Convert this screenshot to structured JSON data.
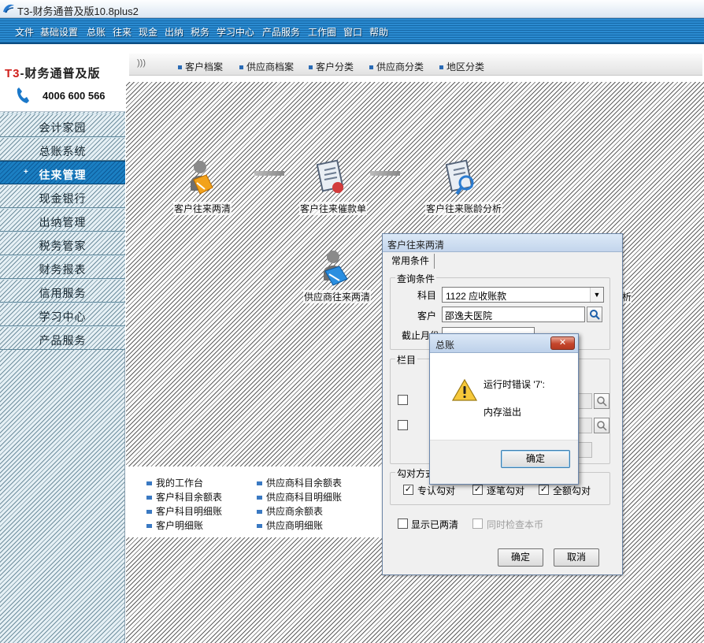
{
  "window": {
    "title": "T3-财务通普及版10.8plus2"
  },
  "menu": [
    "文件",
    "基础设置",
    "总账",
    "往来",
    "现金",
    "出纳",
    "税务",
    "学习中心",
    "产品服务",
    "工作圈",
    "窗口",
    "帮助"
  ],
  "logo": {
    "brand_t3": "T3",
    "brand_rest": "-财务通普及版",
    "phone": "4006 600 566"
  },
  "nav": {
    "items": [
      "会计家园",
      "总账系统",
      "往来管理",
      "现金银行",
      "出纳管理",
      "税务管家",
      "财务报表",
      "信用服务",
      "学习中心",
      "产品服务"
    ],
    "active_index": 2,
    "active_marker": "+"
  },
  "quicklinks": [
    "客户档案",
    "供应商档案",
    "客户分类",
    "供应商分类",
    "地区分类"
  ],
  "flow": {
    "customer_clear": "客户往来两清",
    "customer_statement": "客户往来催款单",
    "customer_aging": "客户往来账龄分析",
    "supplier_clear": "供应商往来两清",
    "supplier_aging_partial": "析"
  },
  "bottom_links": {
    "col1": [
      "我的工作台",
      "客户科目余额表",
      "客户科目明细账",
      "客户明细账"
    ],
    "col2": [
      "供应商科目余额表",
      "供应商科目明细账",
      "供应商余额表",
      "供应商明细账"
    ]
  },
  "dialog_main": {
    "title": "客户往来两清",
    "tab": "常用条件",
    "query_group": "查询条件",
    "subject_label": "科目",
    "subject_value": "1122 应收账款",
    "customer_label": "客户",
    "customer_value": "邵逸夫医院",
    "cutoff_label": "截止月份",
    "column_group": "栏目",
    "match_group": "勾对方式",
    "match_options": [
      {
        "label": "专认勾对",
        "checked": true
      },
      {
        "label": "逐笔勾对",
        "checked": true
      },
      {
        "label": "全额勾对",
        "checked": true
      }
    ],
    "show_cleared": {
      "label": "显示已两清",
      "checked": false
    },
    "check_currency": {
      "label": "同时检查本币",
      "checked": false,
      "disabled": true
    },
    "ok": "确定",
    "cancel": "取消"
  },
  "dialog_error": {
    "title": "总账",
    "close": "✕",
    "line1": "运行时错误 '7':",
    "line2": "内存溢出",
    "ok": "确定"
  },
  "icons": [
    "app-icon",
    "phone-icon",
    "customer-clear-icon",
    "statement-icon",
    "aging-icon",
    "supplier-clear-icon",
    "search-icon",
    "dropdown-icon",
    "warning-icon",
    "close-icon"
  ]
}
